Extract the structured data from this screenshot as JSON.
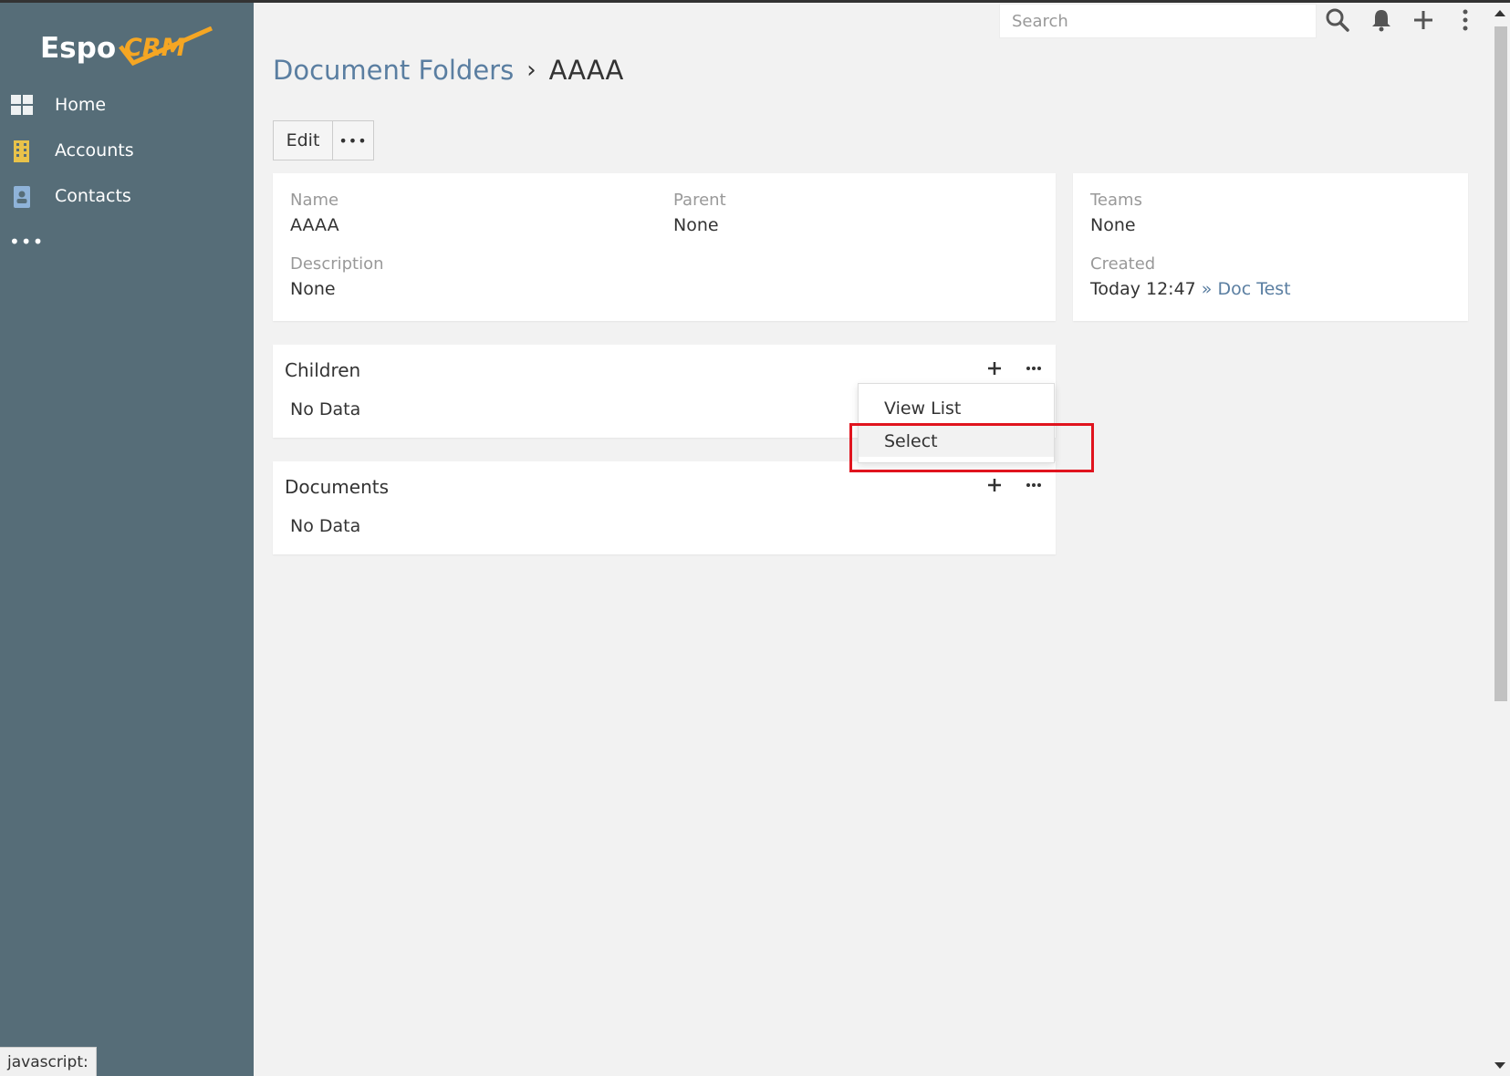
{
  "app": {
    "logo_text": "EspoCRM",
    "colors": {
      "sidebar": "#566d78",
      "link": "#5a7ea1",
      "logo_accent": "#f5a623",
      "highlight": "#e0141e"
    }
  },
  "sidebar": {
    "items": [
      {
        "label": "Home",
        "icon": "dashboard-grid-icon"
      },
      {
        "label": "Accounts",
        "icon": "building-icon"
      },
      {
        "label": "Contacts",
        "icon": "contact-card-icon"
      }
    ],
    "more_label": "•••"
  },
  "header": {
    "search_placeholder": "Search",
    "icons": [
      "search-icon",
      "bell-icon",
      "plus-icon",
      "kebab-menu-icon"
    ]
  },
  "breadcrumb": {
    "parent": "Document Folders",
    "separator": "›",
    "current": "AAAA"
  },
  "actions": {
    "edit_label": "Edit",
    "more_label": "•••"
  },
  "record": {
    "name_label": "Name",
    "name_value": "AAAA",
    "parent_label": "Parent",
    "parent_value": "None",
    "description_label": "Description",
    "description_value": "None"
  },
  "side": {
    "teams_label": "Teams",
    "teams_value": "None",
    "created_label": "Created",
    "created_value": "Today 12:47",
    "created_by_sep": "»",
    "created_by": "Doc Test"
  },
  "panels": {
    "children": {
      "title": "Children",
      "empty": "No Data"
    },
    "documents": {
      "title": "Documents",
      "empty": "No Data"
    }
  },
  "dropdown": {
    "items": [
      "View List",
      "Select"
    ]
  },
  "status_bar": {
    "text": "javascript:"
  }
}
